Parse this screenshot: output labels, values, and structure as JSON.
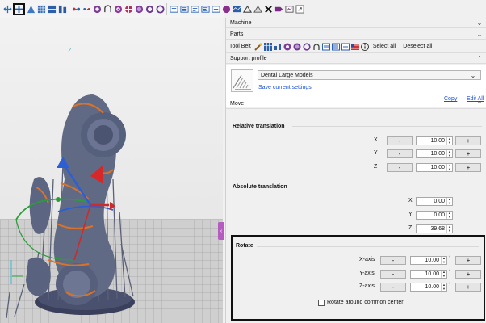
{
  "toolbar": {
    "icons": [
      "move-icon",
      "move-tool-icon",
      "support-icon",
      "grid-icon",
      "layout-icon",
      "parts-icon",
      "connect-icon",
      "cut-icon",
      "hollow-icon",
      "drain-icon",
      "target-icon",
      "circle-icon",
      "sphere-icon",
      "measure-icon",
      "label-icon",
      "paint-icon",
      "align-icon",
      "layers-icon",
      "render-icon",
      "view-icon",
      "camera-icon",
      "brush-icon",
      "flag-icon",
      "export-icon"
    ]
  },
  "panel": {
    "machine": "Machine",
    "parts": "Parts",
    "toolbelt_label": "Tool Belt",
    "select_all": "Select all",
    "deselect_all": "Deselect all",
    "support_profile": "Support profile",
    "profile_value": "Dental Large Models",
    "save_current": "Save current settings",
    "copy": "Copy",
    "edit_all": "Edit All",
    "move": "Move"
  },
  "relative": {
    "title": "Relative translation",
    "rows": [
      {
        "axis": "X",
        "value": "10.00"
      },
      {
        "axis": "Y",
        "value": "10.00"
      },
      {
        "axis": "Z",
        "value": "10.00"
      }
    ]
  },
  "absolute": {
    "title": "Absolute translation",
    "rows": [
      {
        "axis": "X",
        "value": "0.00"
      },
      {
        "axis": "Y",
        "value": "0.00"
      },
      {
        "axis": "Z",
        "value": "39.68"
      }
    ]
  },
  "rotate": {
    "title": "Rotate",
    "rows": [
      {
        "axis": "X-axis",
        "value": "10.00"
      },
      {
        "axis": "Y-axis",
        "value": "10.00"
      },
      {
        "axis": "Z-axis",
        "value": "10.00"
      }
    ],
    "unit": "°",
    "common_center": "Rotate around common center"
  },
  "buttons": {
    "minus": "-",
    "plus": "+"
  },
  "viewport": {
    "axis_z": "Z"
  },
  "colors": {
    "accent_purple": "#b65bc2",
    "link_blue": "#1a4fd6",
    "model_gray": "#606a82",
    "support_orange": "#d9722a"
  }
}
